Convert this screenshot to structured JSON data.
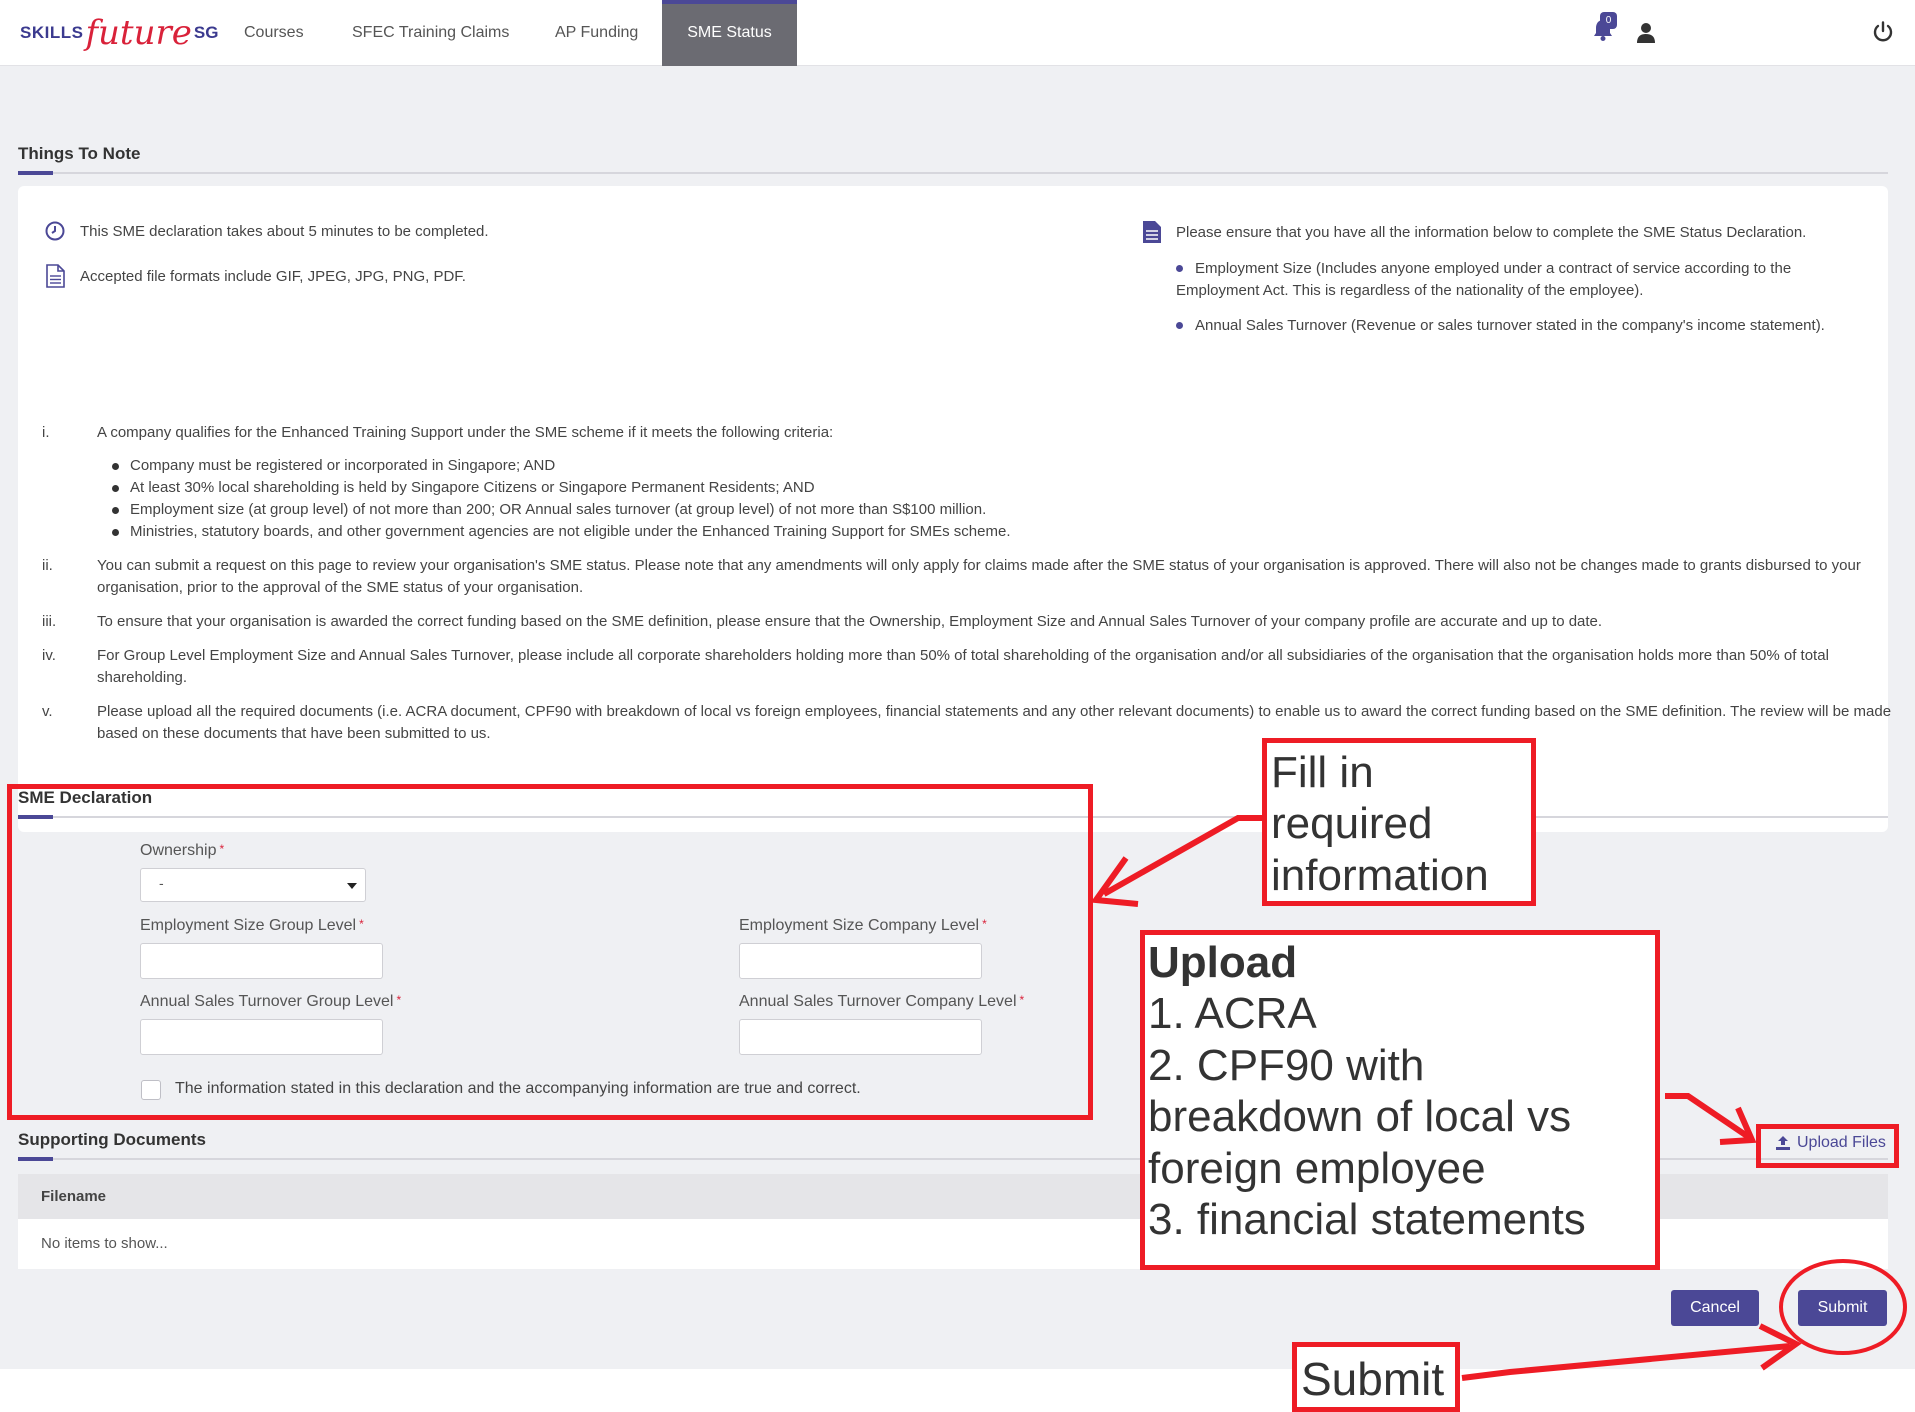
{
  "nav": {
    "logo": {
      "part1": "SKILLS",
      "part2": "future",
      "part3": "SG"
    },
    "links": [
      "Courses",
      "SFEC Training Claims",
      "AP Funding",
      "SME Status"
    ],
    "notification_count": "0"
  },
  "things_to_note": {
    "title": "Things To Note",
    "left": [
      "This SME declaration takes about 5 minutes to be completed.",
      "Accepted file formats include GIF, JPEG, JPG, PNG, PDF."
    ],
    "right_intro": "Please ensure that you have all the information below to complete the SME Status Declaration.",
    "right_bullets": [
      "Employment Size (Includes anyone employed under a contract of service according to the Employment Act. This is regardless of the nationality of the employee).",
      "Annual Sales Turnover (Revenue or sales turnover stated in the company's income statement)."
    ]
  },
  "criteria": {
    "items": [
      {
        "num": "i.",
        "text": "A company qualifies for the Enhanced Training Support under the SME scheme if it meets the following criteria:"
      },
      {
        "num": "ii.",
        "text": "You can submit a request on this page to review your organisation's SME status. Please note that any amendments will only apply for claims made after the SME status of your organisation is approved. There will also not be changes made to grants disbursed to your organisation, prior to the approval of the SME status of your organisation."
      },
      {
        "num": "iii.",
        "text": "To ensure that your organisation is awarded the correct funding based on the SME definition, please ensure that the Ownership, Employment Size and Annual Sales Turnover of your company profile are accurate and up to date."
      },
      {
        "num": "iv.",
        "text": "For Group Level Employment Size and Annual Sales Turnover, please include all corporate shareholders holding more than 50% of total shareholding of the organisation and/or all subsidiaries of the organisation that the organisation holds more than 50% of total shareholding."
      },
      {
        "num": "v.",
        "text": "Please upload all the required documents (i.e. ACRA document, CPF90 with breakdown of local vs foreign employees, financial statements and any other relevant documents) to enable us to award the correct funding based on the SME definition. The review will be made based on these documents that have been submitted to us."
      }
    ],
    "sub_bullets": [
      "Company must be registered or incorporated in Singapore; AND",
      "At least 30% local shareholding is held by Singapore Citizens or Singapore Permanent Residents; AND",
      "Employment size (at group level) of not more than 200; OR Annual sales turnover (at group level) of not more than S$100 million.",
      "Ministries, statutory boards, and other government agencies are not eligible under the Enhanced Training Support for SMEs scheme."
    ]
  },
  "declaration": {
    "title": "SME Declaration",
    "ownership_label": "Ownership",
    "ownership_value": "-",
    "emp_group_label": "Employment Size Group Level",
    "emp_company_label": "Employment Size Company Level",
    "sales_group_label": "Annual Sales Turnover Group Level",
    "sales_company_label": "Annual Sales Turnover Company Level",
    "required_mark": "*",
    "checkbox_label": "The information stated in this declaration and the accompanying information are true and correct."
  },
  "documents": {
    "title": "Supporting Documents",
    "upload_label": "Upload Files",
    "column_filename": "Filename",
    "empty_text": "No items to show..."
  },
  "actions": {
    "cancel": "Cancel",
    "submit": "Submit"
  },
  "annotations": {
    "fill_in": [
      "Fill in",
      "required",
      "information"
    ],
    "upload_title": "Upload",
    "upload_items": [
      "1. ACRA",
      "2. CPF90 with",
      "breakdown of local vs",
      "foreign employee",
      "3. financial statements"
    ],
    "submit": "Submit",
    "color": "#ee1c25"
  },
  "colors": {
    "accent": "#4b4896",
    "required": "#d9223a",
    "page_bg": "#eff0f3"
  }
}
